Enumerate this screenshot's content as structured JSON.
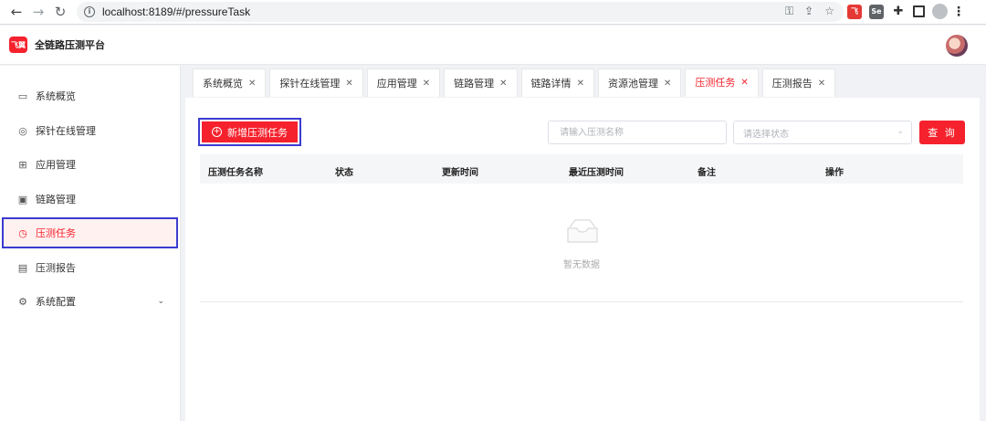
{
  "browser": {
    "url": "localhost:8189/#/pressureTask"
  },
  "app": {
    "logo_text": "飞翼",
    "title": "全链路压测平台"
  },
  "sidebar": {
    "items": [
      {
        "label": "系统概览",
        "icon": "monitor-icon"
      },
      {
        "label": "探针在线管理",
        "icon": "compass-icon"
      },
      {
        "label": "应用管理",
        "icon": "grid-icon"
      },
      {
        "label": "链路管理",
        "icon": "layout-icon"
      },
      {
        "label": "压测任务",
        "icon": "clock-icon",
        "active": true
      },
      {
        "label": "压测报告",
        "icon": "report-icon"
      },
      {
        "label": "系统配置",
        "icon": "gear-icon"
      }
    ]
  },
  "tabs": [
    {
      "label": "系统概览"
    },
    {
      "label": "探针在线管理"
    },
    {
      "label": "应用管理"
    },
    {
      "label": "链路管理"
    },
    {
      "label": "链路详情"
    },
    {
      "label": "资源池管理"
    },
    {
      "label": "压测任务",
      "active": true
    },
    {
      "label": "压测报告"
    }
  ],
  "toolbar": {
    "add_label": "新增压测任务",
    "search_placeholder": "请输入压测名称",
    "status_placeholder": "请选择状态",
    "query_label": "查 询"
  },
  "table": {
    "columns": [
      "压测任务名称",
      "状态",
      "更新时间",
      "最近压测时间",
      "备注",
      "操作"
    ],
    "empty_text": "暂无数据"
  },
  "colors": {
    "accent": "#f5222d",
    "highlight_border": "#3b3bd0"
  }
}
